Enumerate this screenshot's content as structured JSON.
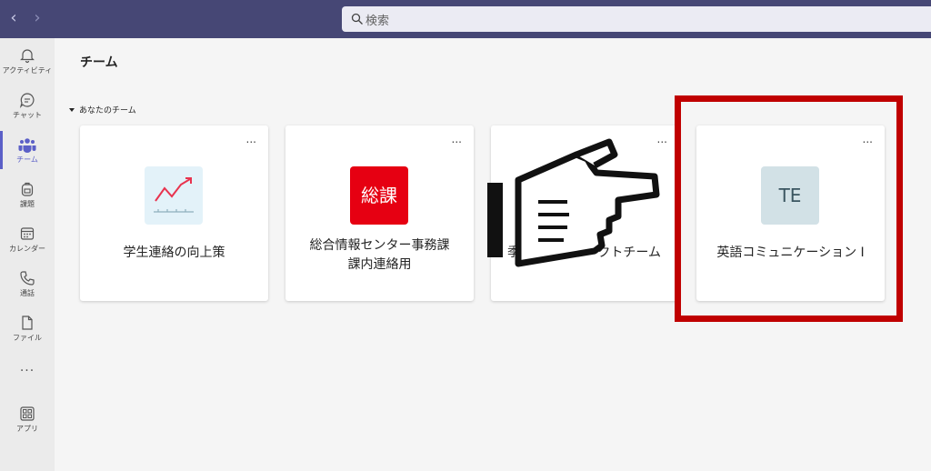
{
  "search": {
    "placeholder": "検索"
  },
  "rail": {
    "items": [
      {
        "label": "アクティビティ",
        "icon": "bell-icon"
      },
      {
        "label": "チャット",
        "icon": "chat-icon"
      },
      {
        "label": "チーム",
        "icon": "teams-icon",
        "active": true
      },
      {
        "label": "課題",
        "icon": "backpack-icon"
      },
      {
        "label": "カレンダー",
        "icon": "calendar-icon"
      },
      {
        "label": "通話",
        "icon": "phone-icon"
      },
      {
        "label": "ファイル",
        "icon": "file-icon"
      }
    ],
    "more": "...",
    "apps_label": "アプリ"
  },
  "main": {
    "title": "チーム",
    "section_label": "あなたのチーム",
    "cards": [
      {
        "name": "学生連絡の向上策",
        "tile": "chart-icon"
      },
      {
        "name": "総合情報センター事務課課内連絡用",
        "name_line1": "総合情報センター事務課",
        "name_line2": "課内連絡用",
        "tile_text": "総課",
        "tile_color": "#e60012"
      },
      {
        "name_left": "季",
        "name_right": "クトチーム"
      },
      {
        "name": "英語コミュニケーション I",
        "tile_text": "TE",
        "tile_color": "#d2e1e6"
      }
    ],
    "more_glyph": "..."
  },
  "colors": {
    "topbar": "#464775",
    "accent": "#5b5fc7",
    "highlight": "#c00000"
  }
}
